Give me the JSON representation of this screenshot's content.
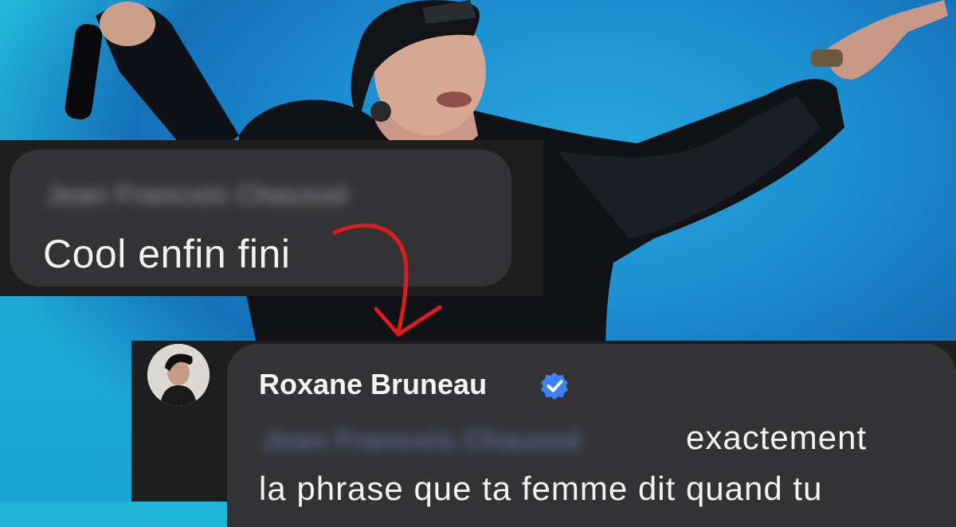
{
  "comment": {
    "author_blurred": "Jean Francois Chaussé",
    "text": "Cool enfin fini"
  },
  "reply": {
    "author": "Roxane Bruneau",
    "verified": true,
    "mention_blurred": "Jean Francois Chaussé",
    "text_line1": "exactement",
    "text_line2": "la phrase que ta femme dit quand tu"
  },
  "colors": {
    "background": "#1fb4d8",
    "bubble": "#333335",
    "card": "#1e1e1e",
    "verified_badge": "#3b82f6",
    "arrow": "#e01b1b"
  },
  "icons": {
    "verified": "verified-badge-icon",
    "arrow": "curved-arrow-icon"
  }
}
